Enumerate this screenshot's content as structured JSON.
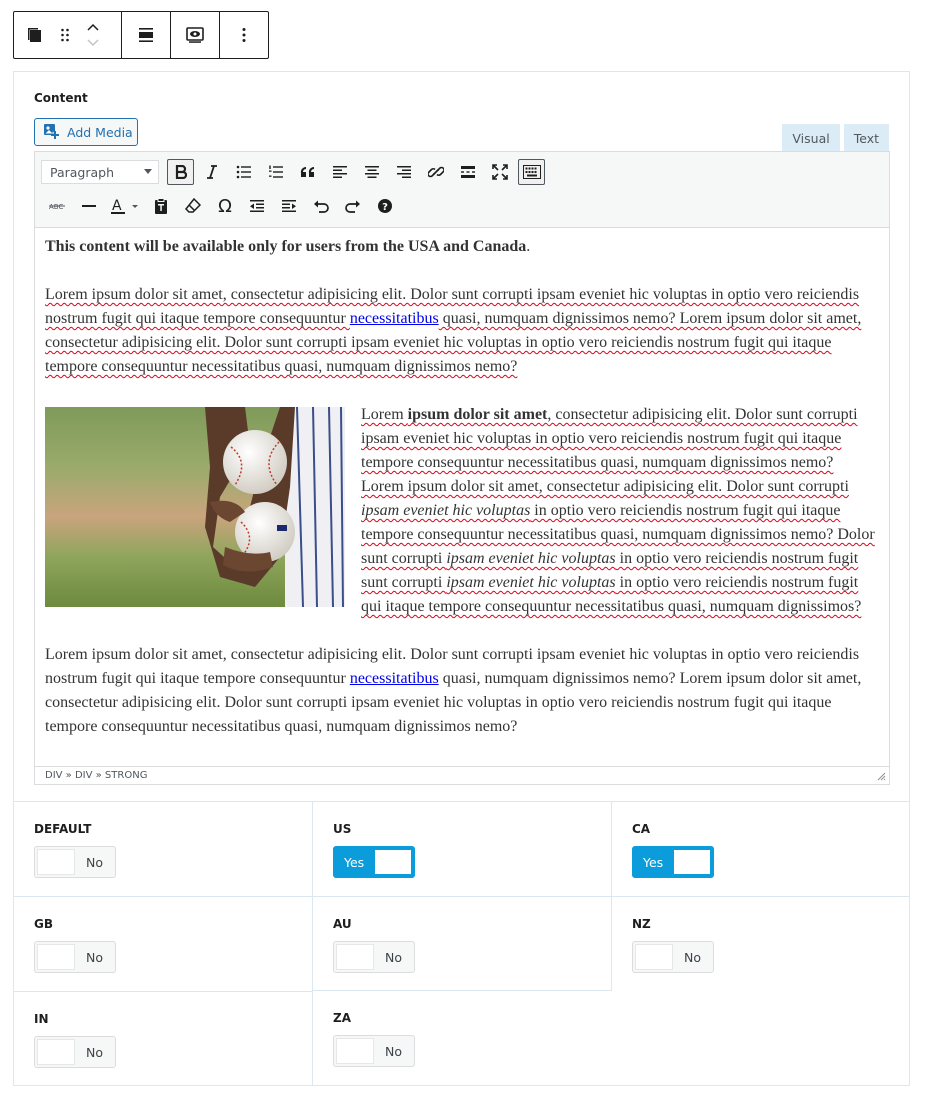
{
  "field": {
    "label": "Content"
  },
  "add_media": {
    "label": "Add Media"
  },
  "tabs": {
    "visual": "Visual",
    "text": "Text"
  },
  "toolbar": {
    "format_select": "Paragraph"
  },
  "content": {
    "heading_bold": "This content will be available only for users from the USA and Canada",
    "heading_period": ".",
    "p1_part1": "Lorem ipsum dolor sit amet, consectetur adipisicing elit. Dolor sunt corrupti ipsam eveniet hic voluptas in optio vero reiciendis nostrum fugit qui itaque tempore consequuntur ",
    "p1_link": "necessitatibus",
    "p1_part2": " quasi, numquam dignissimos nemo? Lorem ipsum dolor sit amet, consectetur adipisicing elit. Dolor sunt corrupti ipsam eveniet hic voluptas in optio vero reiciendis nostrum fugit qui itaque tempore consequuntur necessitatibus quasi, numquam dignissimos nemo?",
    "p2_a": "Lorem ",
    "p2_b_bold": "ipsum dolor sit amet",
    "p2_c": ", consectetur adipisicing elit. Dolor sunt corrupti ipsam eveniet hic voluptas in optio vero reiciendis nostrum fugit qui itaque tempore consequuntur necessitatibus quasi, numquam dignissimos nemo? Lorem ipsum dolor sit amet, consectetur adipisicing elit. Dolor sunt corrupti ",
    "p2_d_italic": "ipsam eveniet hic voluptas",
    "p2_e": " in optio vero reiciendis nostrum fugit qui itaque tempore consequuntur necessitatibus quasi, numquam dignissimos nemo? Dolor sunt corrupti ",
    "p2_f_italic": "ipsam eveniet hic voluptas",
    "p2_g": " in optio vero reiciendis nostrum fugit sunt corrupti ",
    "p2_h_italic": "ipsam eveniet hic voluptas",
    "p2_i": " in optio vero reiciendis nostrum fugit qui itaque tempore consequuntur necessitatibus quasi, numquam dignissimos?",
    "p3_part1": "Lorem ipsum dolor sit amet, consectetur adipisicing elit. Dolor sunt corrupti ipsam eveniet hic voluptas in optio vero reiciendis nostrum fugit qui itaque tempore consequuntur ",
    "p3_link": "necessitatibus",
    "p3_part2": " quasi, numquam dignissimos nemo? Lorem ipsum dolor sit amet, consectetur adipisicing elit. Dolor sunt corrupti ipsam eveniet hic voluptas in optio vero reiciendis nostrum fugit qui itaque tempore consequuntur necessitatibus quasi, numquam dignissimos nemo?"
  },
  "path": "DIV » DIV » STRONG",
  "countries": [
    {
      "code": "DEFAULT",
      "value": "No"
    },
    {
      "code": "US",
      "value": "Yes"
    },
    {
      "code": "CA",
      "value": "Yes"
    },
    {
      "code": "GB",
      "value": "No"
    },
    {
      "code": "AU",
      "value": "No"
    },
    {
      "code": "NZ",
      "value": "No"
    },
    {
      "code": "IN",
      "value": "No"
    },
    {
      "code": "ZA",
      "value": "No"
    }
  ],
  "colors": {
    "accent": "#0a9cdb",
    "link": "#2271b1"
  }
}
